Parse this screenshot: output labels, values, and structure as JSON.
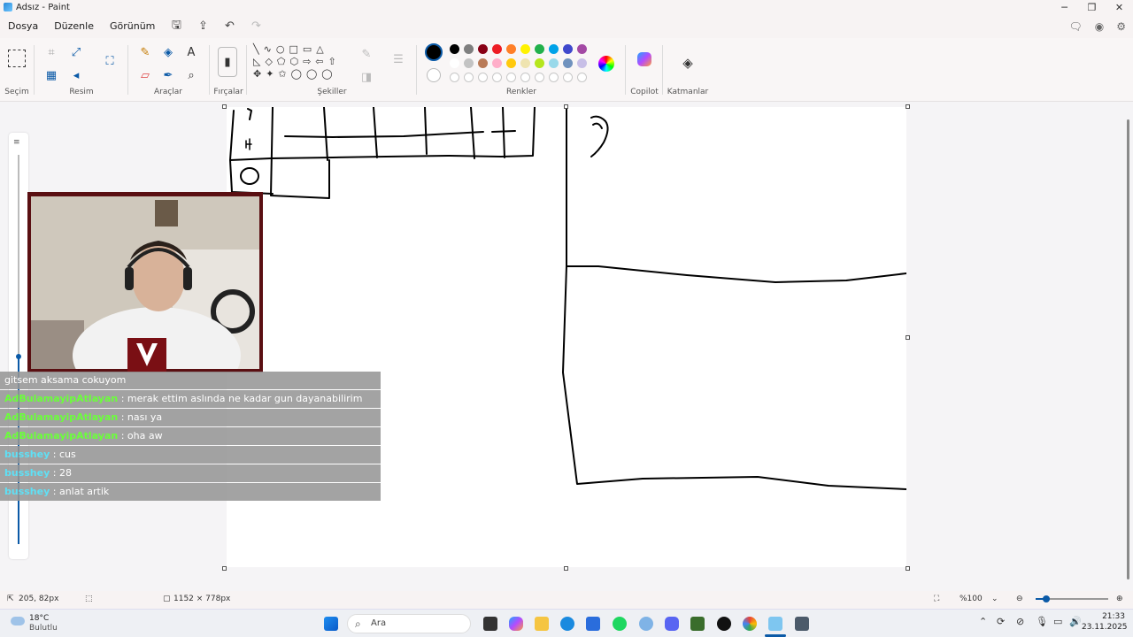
{
  "window": {
    "title": "Adsız - Paint"
  },
  "menu": {
    "items": [
      "Dosya",
      "Düzenle",
      "Görünüm"
    ]
  },
  "ribbon": {
    "groups": {
      "selection": "Seçim",
      "image": "Resim",
      "tools": "Araçlar",
      "brushes": "Fırçalar",
      "shapes": "Şekiller",
      "colors": "Renkler",
      "copilot": "Copilot",
      "layers": "Katmanlar"
    },
    "colors": [
      "#000000",
      "#7f7f7f",
      "#880015",
      "#ed1c24",
      "#ff7f27",
      "#fff200",
      "#22b14c",
      "#00a2e8",
      "#3f48cc",
      "#a349a4"
    ],
    "colors_row2": [
      "#ffffff",
      "#c3c3c3",
      "#b97a57",
      "#ffaec9",
      "#ffc90e",
      "#efe4b0",
      "#b5e61d",
      "#99d9ea",
      "#7092be",
      "#c8bfe7"
    ],
    "active_color": "#000000"
  },
  "chat": [
    {
      "nick": "",
      "message": "gitsem aksama cokuyom",
      "nick_color": "#ffffff"
    },
    {
      "nick": "AdBulamayipAtlayan",
      "message": " : merak ettim aslında ne kadar gun dayanabilirim",
      "nick_color": "#6bff3a"
    },
    {
      "nick": "AdBulamayipAtlayan",
      "message": " : nası ya",
      "nick_color": "#6bff3a"
    },
    {
      "nick": "AdBulamayipAtlayan",
      "message": " : oha aw",
      "nick_color": "#6bff3a"
    },
    {
      "nick": "busshey",
      "message": " : cus",
      "nick_color": "#5fe0f5"
    },
    {
      "nick": "busshey",
      "message": " : 28",
      "nick_color": "#5fe0f5"
    },
    {
      "nick": "busshey",
      "message": " : anlat artik",
      "nick_color": "#5fe0f5"
    }
  ],
  "canvas_drawing": {
    "digit_4": "4"
  },
  "status": {
    "cursor_pos": "205, 82px",
    "canvas_size": "1152 × 778px",
    "zoom": "%100"
  },
  "taskbar": {
    "weather_temp": "18°C",
    "weather_desc": "Bulutlu",
    "search_placeholder": "Ara",
    "time": "21:33",
    "date": "23.11.2025"
  }
}
